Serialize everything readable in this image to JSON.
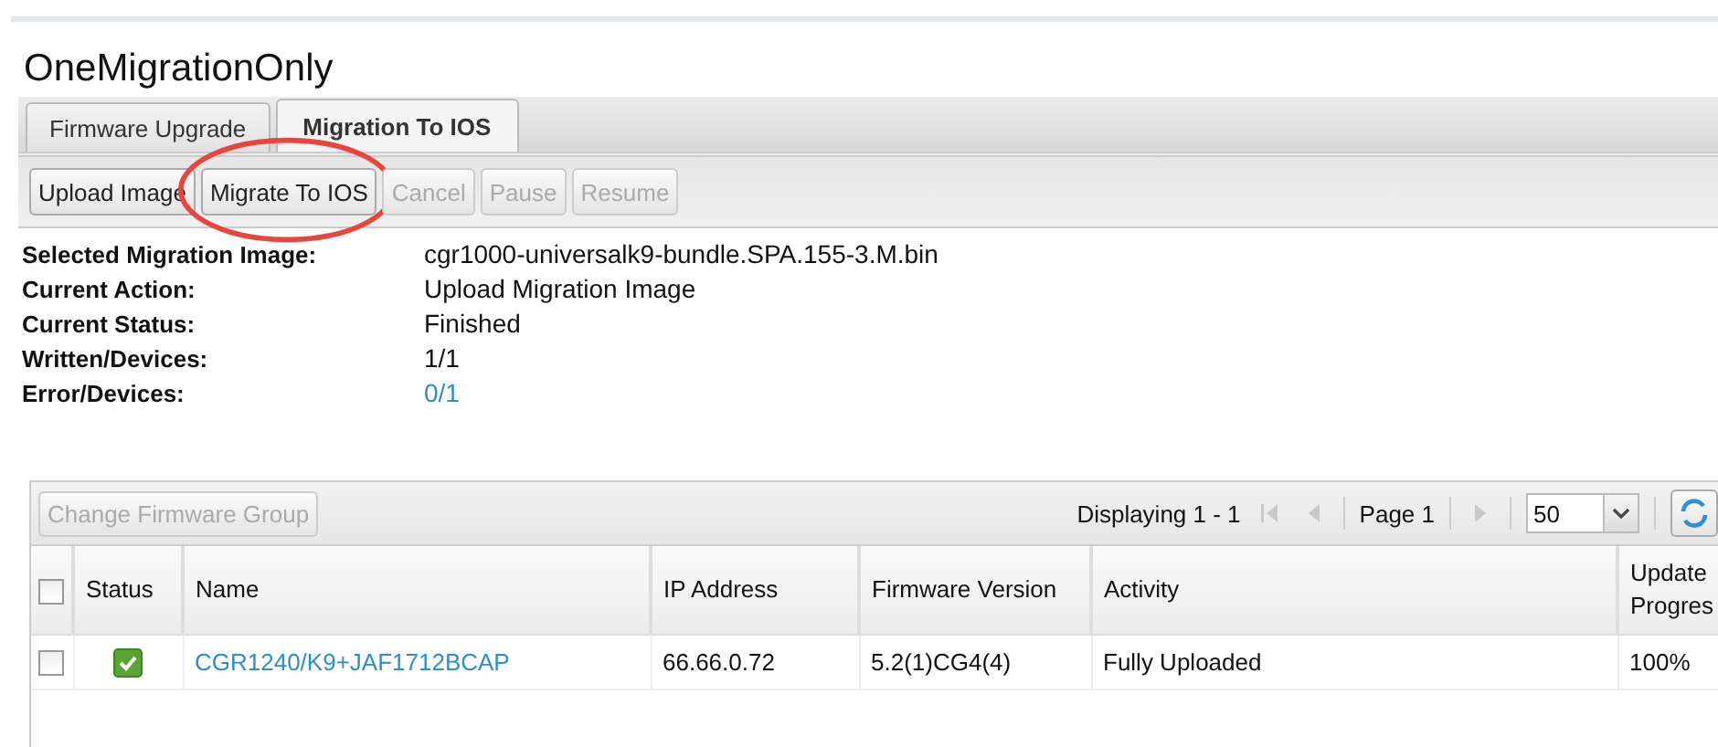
{
  "page_title": "OneMigrationOnly",
  "tabs": [
    {
      "label": "Firmware Upgrade",
      "selected": false
    },
    {
      "label": "Migration To IOS",
      "selected": true
    }
  ],
  "toolbar_buttons": [
    {
      "label": "Upload Image",
      "disabled": false,
      "highlighted": false
    },
    {
      "label": "Migrate To IOS",
      "disabled": false,
      "highlighted": true
    },
    {
      "label": "Cancel",
      "disabled": true,
      "highlighted": false
    },
    {
      "label": "Pause",
      "disabled": true,
      "highlighted": false
    },
    {
      "label": "Resume",
      "disabled": true,
      "highlighted": false
    }
  ],
  "details": [
    {
      "label": "Selected Migration Image:",
      "value": "cgr1000-universalk9-bundle.SPA.155-3.M.bin",
      "link": false
    },
    {
      "label": "Current Action:",
      "value": "Upload Migration Image",
      "link": false
    },
    {
      "label": "Current Status:",
      "value": "Finished",
      "link": false
    },
    {
      "label": "Written/Devices:",
      "value": "1/1",
      "link": false
    },
    {
      "label": "Error/Devices:",
      "value": "0/1",
      "link": true
    }
  ],
  "grid": {
    "button": {
      "label": "Change Firmware Group",
      "disabled": true
    },
    "paging_info": "Displaying 1 - 1",
    "page_label": "Page 1",
    "page_size": "50",
    "select_all": false,
    "columns": [
      "Status",
      "Name",
      "IP Address",
      "Firmware Version",
      "Activity",
      "Update Progres"
    ],
    "rows": [
      {
        "checked": false,
        "success": true,
        "name": "CGR1240/K9+JAF1712BCAP",
        "ip": "66.66.0.72",
        "firmware": "5.2(1)CG4(4)",
        "activity": "Fully Uploaded",
        "progress": "100%"
      }
    ]
  }
}
